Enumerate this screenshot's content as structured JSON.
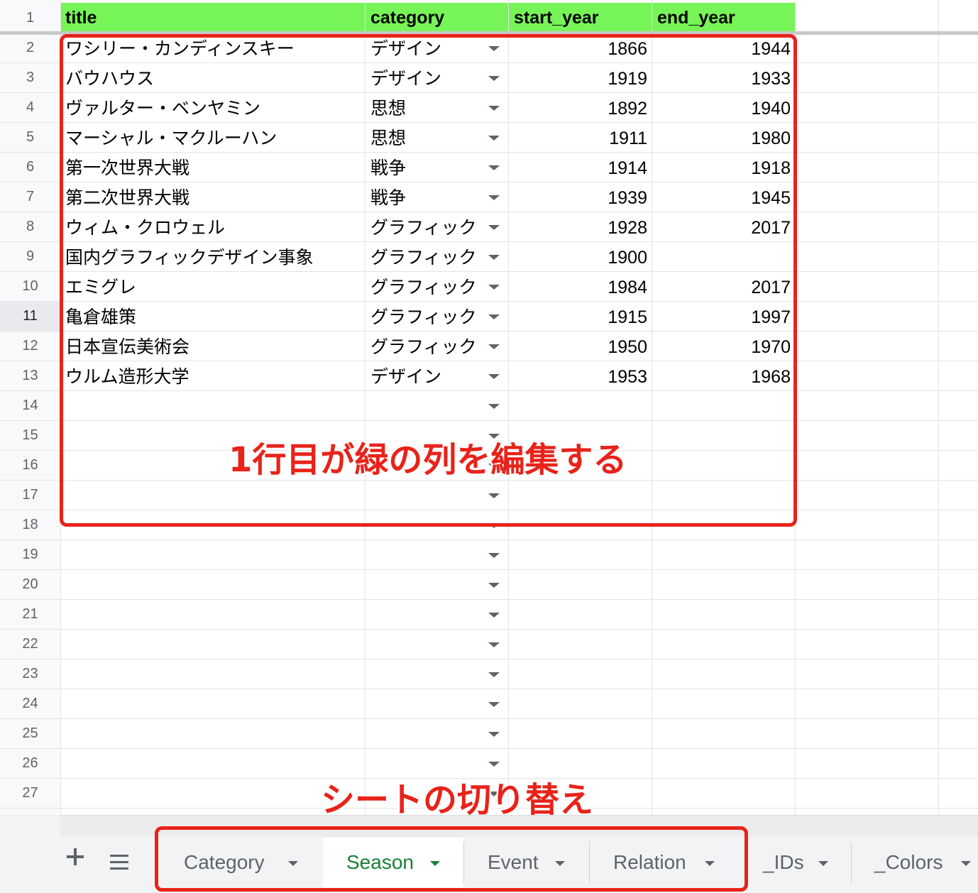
{
  "columns": [
    "title",
    "category",
    "start_year",
    "end_year"
  ],
  "row_numbers": [
    "1",
    "2",
    "3",
    "4",
    "5",
    "6",
    "7",
    "8",
    "9",
    "10",
    "11",
    "12",
    "13",
    "14",
    "15",
    "16",
    "17",
    "18",
    "19",
    "20",
    "21",
    "22",
    "23",
    "24",
    "25",
    "26",
    "27"
  ],
  "rows": [
    {
      "title": "ワシリー・カンディンスキー",
      "category": "デザイン",
      "start_year": "1866",
      "end_year": "1944"
    },
    {
      "title": "バウハウス",
      "category": "デザイン",
      "start_year": "1919",
      "end_year": "1933"
    },
    {
      "title": "ヴァルター・ベンヤミン",
      "category": "思想",
      "start_year": "1892",
      "end_year": "1940"
    },
    {
      "title": "マーシャル・マクルーハン",
      "category": "思想",
      "start_year": "1911",
      "end_year": "1980"
    },
    {
      "title": "第一次世界大戦",
      "category": "戦争",
      "start_year": "1914",
      "end_year": "1918"
    },
    {
      "title": "第二次世界大戦",
      "category": "戦争",
      "start_year": "1939",
      "end_year": "1945"
    },
    {
      "title": "ウィム・クロウェル",
      "category": "グラフィック",
      "start_year": "1928",
      "end_year": "2017"
    },
    {
      "title": "国内グラフィックデザイン事象",
      "category": "グラフィック",
      "start_year": "1900",
      "end_year": ""
    },
    {
      "title": "エミグレ",
      "category": "グラフィック",
      "start_year": "1984",
      "end_year": "2017"
    },
    {
      "title": "亀倉雄策",
      "category": "グラフィック",
      "start_year": "1915",
      "end_year": "1997"
    },
    {
      "title": "日本宣伝美術会",
      "category": "グラフィック",
      "start_year": "1950",
      "end_year": "1970"
    },
    {
      "title": "ウルム造形大学",
      "category": "デザイン",
      "start_year": "1953",
      "end_year": "1968"
    }
  ],
  "annotations": {
    "edit_columns": "1行目が緑の列を編集する",
    "switch_sheets": "シートの切り替え"
  },
  "sheet_tabs": [
    {
      "label": "Category",
      "active": false
    },
    {
      "label": "Season",
      "active": true
    },
    {
      "label": "Event",
      "active": false
    },
    {
      "label": "Relation",
      "active": false
    },
    {
      "label": "_IDs",
      "active": false
    },
    {
      "label": "_Colors",
      "active": false
    }
  ],
  "colors": {
    "header_fill": "#77f457",
    "annotation_red": "#e8231a",
    "active_tab_text": "#188038"
  },
  "icons": {
    "add_sheet": "plus-icon",
    "all_sheets": "menu-lines-icon",
    "dropdown": "caret-down-icon"
  }
}
